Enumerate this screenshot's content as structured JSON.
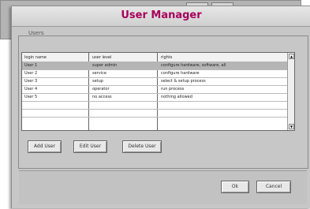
{
  "dialog": {
    "title": "User Manager",
    "group_label": "Users"
  },
  "table": {
    "columns": [
      "login name",
      "user level",
      "rights"
    ],
    "rows": [
      [
        "User 1",
        "super admin",
        "configure hardware, software, all"
      ],
      [
        "User 2",
        "service",
        "configure hardware"
      ],
      [
        "User 3",
        "setup",
        "select & setup process"
      ],
      [
        "User 4",
        "operator",
        "run process"
      ],
      [
        "User 5",
        "no access",
        "nothing allowed"
      ]
    ]
  },
  "buttons": {
    "add": "Add User",
    "edit": "Edit User",
    "delete": "Delete User",
    "ok": "Ok",
    "cancel": "Cancel"
  },
  "colors": {
    "title": "#a8005a",
    "selected": "#b5b5b5"
  }
}
